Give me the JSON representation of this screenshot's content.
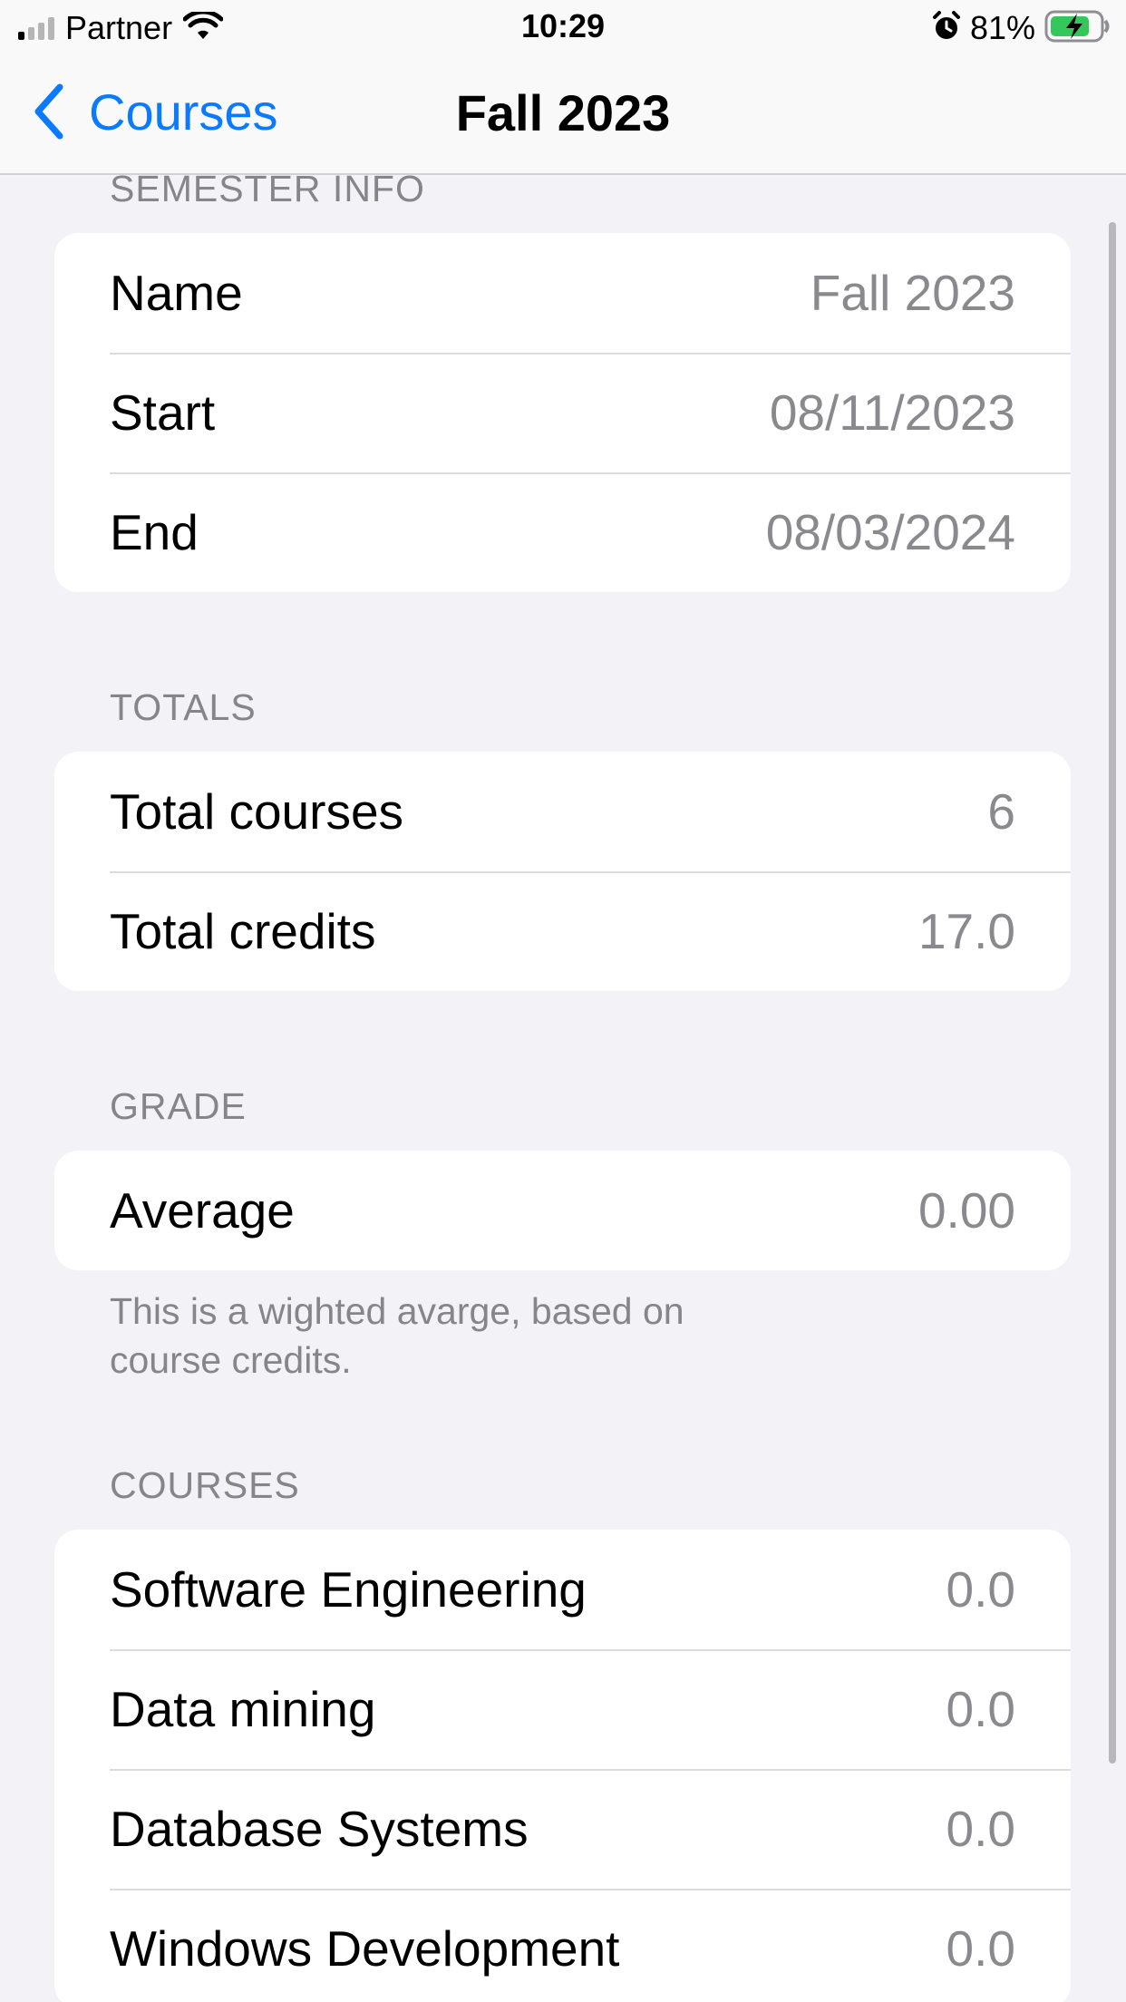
{
  "status_bar": {
    "carrier": "Partner",
    "time": "10:29",
    "battery": "81%",
    "signal_icon": "cellular-signal-icon",
    "wifi_icon": "wifi-icon",
    "alarm_icon": "alarm-clock-icon",
    "battery_icon": "battery-charging-icon",
    "battery_level": 0.81,
    "battery_color": "#34c759"
  },
  "nav": {
    "back_label": "Courses",
    "title": "Fall 2023",
    "back_icon": "chevron-left-icon",
    "accent": "#0a7aff"
  },
  "sections": {
    "semester_info": {
      "header": "SEMESTER INFO",
      "rows": [
        {
          "label": "Name",
          "value": "Fall 2023"
        },
        {
          "label": "Start",
          "value": "08/11/2023"
        },
        {
          "label": "End",
          "value": "08/03/2024"
        }
      ]
    },
    "totals": {
      "header": "TOTALS",
      "rows": [
        {
          "label": "Total courses",
          "value": "6"
        },
        {
          "label": "Total credits",
          "value": "17.0"
        }
      ]
    },
    "grade": {
      "header": "GRADE",
      "rows": [
        {
          "label": "Average",
          "value": "0.00"
        }
      ],
      "footer": "This is a wighted avarge, based on course credits."
    },
    "courses": {
      "header": "COURSES",
      "rows": [
        {
          "label": "Software Engineering",
          "value": "0.0"
        },
        {
          "label": "Data mining",
          "value": "0.0"
        },
        {
          "label": "Database Systems",
          "value": "0.0"
        },
        {
          "label": "Windows Development",
          "value": "0.0"
        }
      ]
    }
  }
}
